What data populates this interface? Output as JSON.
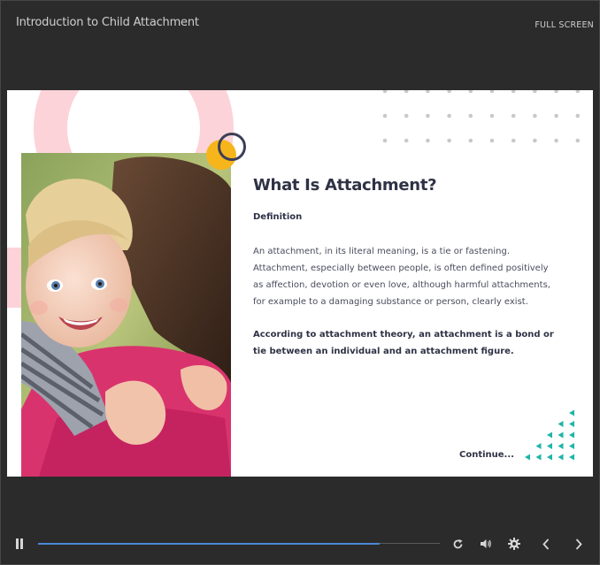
{
  "app": {
    "title": "Introduction to Child Attachment",
    "fullscreen_label": "FULL SCREEN"
  },
  "slide": {
    "heading": "What Is Attachment?",
    "subheading": "Definition",
    "paragraph": "An attachment, in its literal meaning, is a tie or fastening. Attachment, especially between people, is often defined positively as affection, devotion or even love, although harmful attachments, for example to a damaging substance or person, clearly exist.",
    "paragraph_bold": "According to attachment theory, an attachment is a bond or tie between an individual and an attachment figure.",
    "continue_label": "Continue...",
    "photo_description": "photo-mother-child-hug",
    "colors": {
      "pink": "#fcd3d9",
      "yellow": "#f7b51c",
      "navy": "#3d3f57",
      "teal": "#1fb5a9"
    }
  },
  "player": {
    "progress": 0.85,
    "icons": {
      "pause": "pause-icon",
      "replay": "replay-icon",
      "volume": "volume-icon",
      "settings": "gear-icon",
      "prev": "chevron-left-icon",
      "next": "chevron-right-icon"
    },
    "accent": "#4a89d6"
  }
}
